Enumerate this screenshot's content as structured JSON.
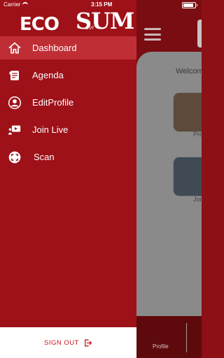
{
  "status_bar": {
    "carrier": "Carrier",
    "time": "3:15 PM"
  },
  "logo": {
    "eco": "ECO",
    "sum": "SUM",
    "sub": "UVI"
  },
  "menu": {
    "items": [
      {
        "label": "Dashboard",
        "icon": "home-icon",
        "active": true
      },
      {
        "label": "Agenda",
        "icon": "agenda-icon",
        "active": false
      },
      {
        "label": "EditProfile",
        "icon": "profile-icon",
        "active": false
      },
      {
        "label": "Join Live",
        "icon": "live-icon",
        "active": false
      },
      {
        "label": "Scan",
        "icon": "scan-icon",
        "active": false
      }
    ]
  },
  "footer": {
    "signout_label": "SIGN OUT"
  },
  "background": {
    "welcome_text": "Welcom",
    "card1_label": "Pro",
    "card2_label": "Join",
    "bottom_tab_label": "Profile"
  },
  "colors": {
    "drawer_bg": "#9e1118",
    "active_item_bg": "#c02e35",
    "signout_text": "#c4171f"
  }
}
